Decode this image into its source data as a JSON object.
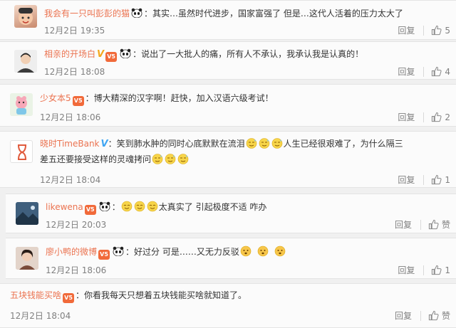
{
  "comments": [
    {
      "username": "我会有一只叫彭彭的猫",
      "text": "：其实…虽然时代进步，国家富强了 但是…这代人活着的压力太大了",
      "time": "12月2日 19:35",
      "reply_label": "回复",
      "likes": "5",
      "badges": [
        "panda"
      ]
    },
    {
      "username": "相亲的开场白",
      "text": "：说出了一大批人的痛，所有人不承认，我承认我是认真的！",
      "time": "12月2日 18:08",
      "reply_label": "回复",
      "likes": "4",
      "badges": [
        "v-yellow",
        "vip",
        "panda"
      ]
    },
    {
      "username": "少女本5",
      "text": "：博大精深的汉字啊！赶快，加入汉语六级考试！",
      "time": "12月2日 18:06",
      "reply_label": "回复",
      "likes": "2",
      "badges": [
        "vip"
      ]
    },
    {
      "username": "晓时TimeBank",
      "text_before": "：笑到肺水肿的同时心底默默在流泪",
      "text_middle": "人生已经很艰难了，为什么隔三",
      "text_line2": "差五还要接受这样的灵魂拷问",
      "time": "12月2日 18:04",
      "reply_label": "回复",
      "likes": "1",
      "badges": [
        "v-blue"
      ]
    },
    {
      "username": "likewena",
      "text": "太真实了 引起极度不适  咋办",
      "time": "12月2日 20:03",
      "reply_label": "回复",
      "likes": "赞",
      "badges": [
        "vip",
        "panda"
      ]
    },
    {
      "username": "廖小鸭的微博",
      "text": "：好过分 可是……又无力反驳",
      "time": "12月2日 18:06",
      "reply_label": "回复",
      "likes": "1",
      "badges": [
        "vip",
        "panda"
      ]
    },
    {
      "username": "五块钱能买啥",
      "text": "：你看我每天只想着五块钱能买啥就知道了。",
      "time": "12月2日 18:04",
      "reply_label": "回复",
      "likes": "赞",
      "badges": [
        "vip"
      ]
    }
  ],
  "icons": {
    "like": "thumbs-up-icon",
    "panda": "panda-emoji-icon",
    "vip": "vip-badge-icon"
  },
  "colors": {
    "username": "#eb7350",
    "timestamp": "#808080",
    "body_text": "#333333",
    "background": "#f0f0f0"
  }
}
